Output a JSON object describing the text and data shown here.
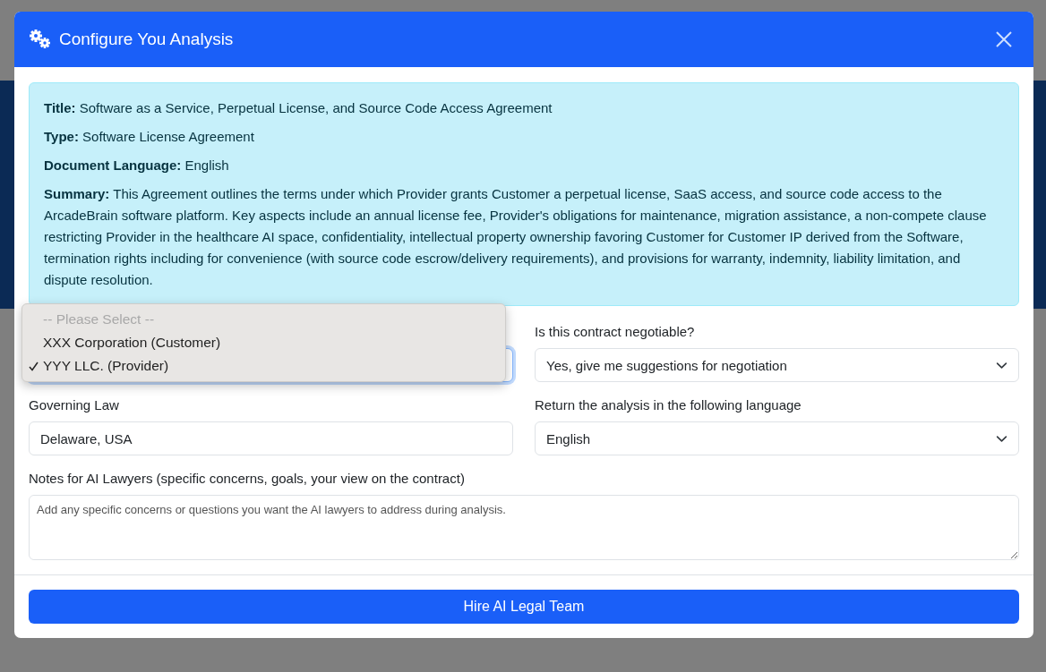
{
  "modal": {
    "title": "Configure You Analysis"
  },
  "info": [
    {
      "text": "**Title:** Software as a Service, Perpetual License, and Source Code Access Agreement"
    },
    {
      "text": "**Type:** Software License Agreement"
    },
    {
      "text": "**Document Language:** English"
    },
    {
      "text": "**Summary:** This Agreement outlines the terms under which Provider grants Customer a perpetual license, SaaS access, and source code access to the ArcadeBrain software platform. Key aspects include an annual license fee, Provider's obligations for maintenance, migration assistance, a non-compete clause restricting Provider in the healthcare AI space, confidentiality, intellectual property ownership favoring Customer for Customer IP derived from the Software, termination rights including for convenience (with source code escrow/delivery requirements), and provisions for warranty, indemnity, liability limitation, and dispute resolution."
    }
  ],
  "party_select": {
    "expanded": true,
    "options": [
      {
        "label": "-- Please Select --",
        "disabled": true,
        "selected": false
      },
      {
        "label": "XXX Corporation (Customer)",
        "disabled": false,
        "selected": false
      },
      {
        "label": "YYY LLC. (Provider)",
        "disabled": false,
        "selected": true
      }
    ]
  },
  "fields": [
    {
      "kind": "select",
      "label": "Is this contract negotiable?",
      "value": "Yes, give me suggestions for negotiation"
    },
    {
      "kind": "input",
      "label": "Governing Law",
      "value": "Delaware, USA"
    },
    {
      "kind": "select",
      "label": "Return the analysis in the following language",
      "value": "English"
    }
  ],
  "notes": {
    "label": "Notes for AI Lawyers (specific concerns, goals, your view on the contract)",
    "placeholder": "Add any specific concerns or questions you want the AI lawyers to address during analysis."
  },
  "submit_button": "Hire AI Legal Team"
}
